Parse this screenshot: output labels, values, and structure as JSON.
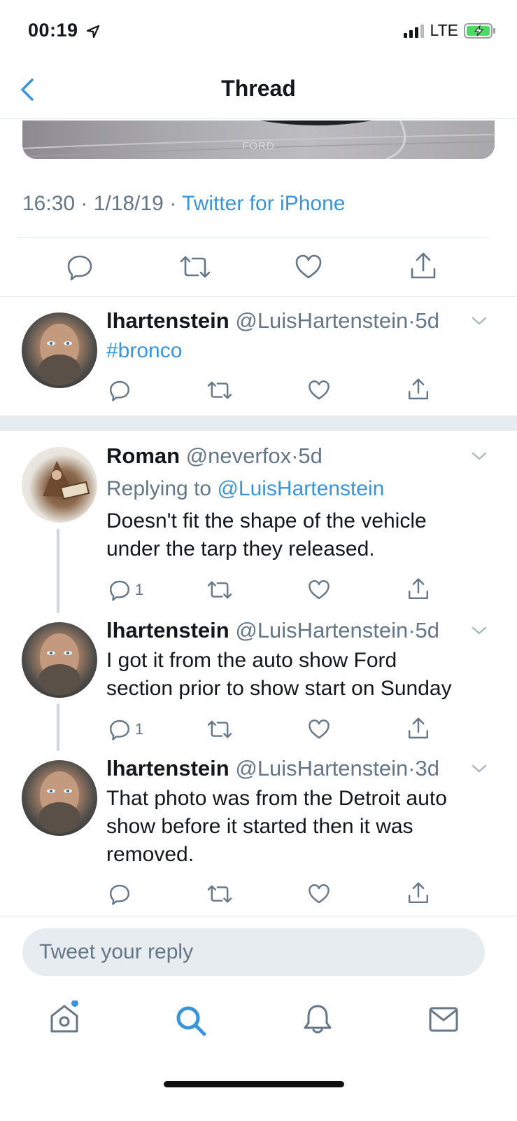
{
  "status_bar": {
    "time": "00:19",
    "network": "LTE"
  },
  "nav": {
    "title": "Thread"
  },
  "media": {
    "caption_text": "FORD"
  },
  "main_tweet": {
    "time": "16:30",
    "date": "1/18/19",
    "source": "Twitter for iPhone",
    "sep": "·"
  },
  "tweets": [
    {
      "name": "lhartenstein",
      "handle": "@LuisHartenstein",
      "dot": "·",
      "age": "5d",
      "text": "#bronco",
      "reply_count": ""
    },
    {
      "name": "Roman",
      "handle": "@neverfox",
      "dot": "·",
      "age": "5d",
      "replying_prefix": "Replying to",
      "replying_to": "@LuisHartenstein",
      "text_line1": "Doesn't fit the shape of the vehicle",
      "text_line2": "under the tarp they released.",
      "reply_count": "1"
    },
    {
      "name": "lhartenstein",
      "handle": "@LuisHartenstein",
      "dot": "·",
      "age": "5d",
      "text_line1": "I got it from the auto show Ford",
      "text_line2": "section prior to show start on Sunday",
      "reply_count": "1"
    },
    {
      "name": "lhartenstein",
      "handle": "@LuisHartenstein",
      "dot": "·",
      "age": "3d",
      "text_line1": "That photo was from the Detroit auto",
      "text_line2": "show before it started then it was",
      "text_line3": "removed.",
      "reply_count": ""
    }
  ],
  "reply_box": {
    "placeholder": "Tweet your reply"
  },
  "tab_bar": {
    "items": [
      "home-icon",
      "search-icon",
      "notifications-icon",
      "messages-icon"
    ],
    "active": "search-icon",
    "accent": "#3b94d9"
  },
  "colors": {
    "accent": "#3b94d9",
    "muted": "#657786",
    "divider": "#e1e8ed"
  }
}
